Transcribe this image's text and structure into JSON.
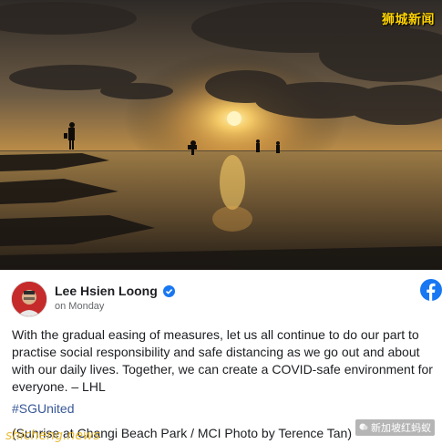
{
  "watermarks": {
    "top_right": "狮城新闻",
    "bottom_left": "shicheng.news",
    "bottom_right": "新加坡红蚂蚁"
  },
  "post": {
    "author": "Lee Hsien Loong",
    "time": "on Monday",
    "body": "With the gradual easing of measures, let us all continue to do our part to practise social responsibility and safe distancing as we go out and about with our daily lives. Together, we can create a COVID-safe environment for everyone. – LHL",
    "hashtag": "#SGUnited",
    "caption": "(Sunrise at Changi Beach Park / MCI Photo by Terence Tan)"
  },
  "icons": {
    "verified": "verified-badge-icon",
    "platform": "facebook-logo-icon",
    "avatar": "profile-photo"
  },
  "colors": {
    "link": "#385898",
    "facebook_blue": "#1877f2"
  }
}
